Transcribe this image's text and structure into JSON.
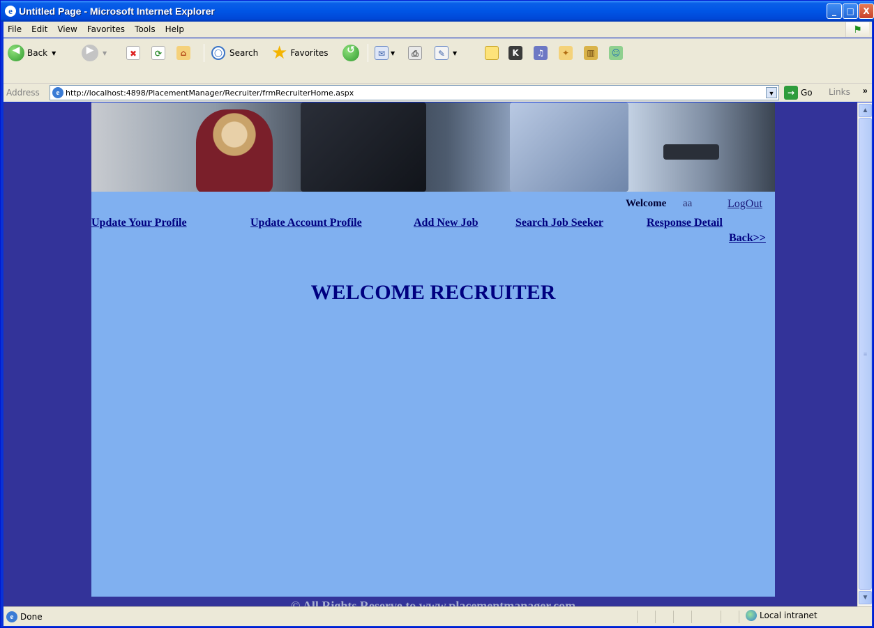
{
  "window": {
    "title": "Untitled Page - Microsoft Internet Explorer",
    "controls": {
      "minimize": "_",
      "maximize": "□",
      "close": "X"
    }
  },
  "menubar": {
    "items": [
      {
        "label": "File",
        "hotkey": "F"
      },
      {
        "label": "Edit",
        "hotkey": "E"
      },
      {
        "label": "View",
        "hotkey": "V"
      },
      {
        "label": "Favorites",
        "hotkey": "a"
      },
      {
        "label": "Tools",
        "hotkey": "T"
      },
      {
        "label": "Help",
        "hotkey": "H"
      }
    ]
  },
  "toolbar": {
    "back_label": "Back",
    "search_label": "Search",
    "favorites_label": "Favorites"
  },
  "address": {
    "label": "Address",
    "url": "http://localhost:4898/PlacementManager/Recruiter/frmRecruiterHome.aspx",
    "go_label": "Go",
    "links_label": "Links"
  },
  "page": {
    "welcome_label": "Welcome",
    "user_name": "aa",
    "logout_label": "LogOut",
    "nav": {
      "update_profile": "Update Your Profile",
      "update_account": "Update Account Profile",
      "add_job": "Add New Job",
      "search_seeker": "Search Job Seeker",
      "response_detail": "Response Detail",
      "back": "Back>>"
    },
    "heading": "WELCOME RECRUITER",
    "footer": "© All Rights Reserve to www.placementmanager.com",
    "colors": {
      "page_bg": "#80b0f0",
      "outer_bg": "#333399",
      "link": "#000080"
    }
  },
  "statusbar": {
    "status": "Done",
    "zone": "Local intranet"
  }
}
